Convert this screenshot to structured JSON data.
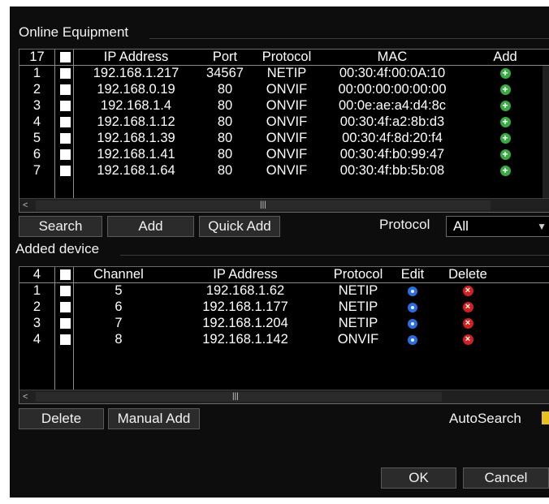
{
  "online": {
    "title": "Online Equipment",
    "count": "17",
    "headers": {
      "ip": "IP Address",
      "port": "Port",
      "protocol": "Protocol",
      "mac": "MAC",
      "add": "Add"
    },
    "rows": [
      {
        "no": "1",
        "ip": "192.168.1.217",
        "port": "34567",
        "protocol": "NETIP",
        "mac": "00:30:4f:00:0A:10"
      },
      {
        "no": "2",
        "ip": "192.168.0.19",
        "port": "80",
        "protocol": "ONVIF",
        "mac": "00:00:00:00:00:00"
      },
      {
        "no": "3",
        "ip": "192.168.1.4",
        "port": "80",
        "protocol": "ONVIF",
        "mac": "00:0e:ae:a4:d4:8c"
      },
      {
        "no": "4",
        "ip": "192.168.1.12",
        "port": "80",
        "protocol": "ONVIF",
        "mac": "00:30:4f:a2:8b:d3"
      },
      {
        "no": "5",
        "ip": "192.168.1.39",
        "port": "80",
        "protocol": "ONVIF",
        "mac": "00:30:4f:8d:20:f4"
      },
      {
        "no": "6",
        "ip": "192.168.1.41",
        "port": "80",
        "protocol": "ONVIF",
        "mac": "00:30:4f:b0:99:47"
      },
      {
        "no": "7",
        "ip": "192.168.1.64",
        "port": "80",
        "protocol": "ONVIF",
        "mac": "00:30:4f:bb:5b:08"
      }
    ]
  },
  "online_buttons": {
    "search": "Search",
    "add": "Add",
    "quick_add": "Quick Add"
  },
  "protocol_filter": {
    "label": "Protocol",
    "value": "All"
  },
  "added": {
    "title": "Added device",
    "count": "4",
    "headers": {
      "channel": "Channel",
      "ip": "IP Address",
      "protocol": "Protocol",
      "edit": "Edit",
      "delete": "Delete"
    },
    "rows": [
      {
        "no": "1",
        "channel": "5",
        "ip": "192.168.1.62",
        "protocol": "NETIP"
      },
      {
        "no": "2",
        "channel": "6",
        "ip": "192.168.1.177",
        "protocol": "NETIP"
      },
      {
        "no": "3",
        "channel": "7",
        "ip": "192.168.1.204",
        "protocol": "NETIP"
      },
      {
        "no": "4",
        "channel": "8",
        "ip": "192.168.1.142",
        "protocol": "ONVIF"
      }
    ]
  },
  "added_buttons": {
    "delete": "Delete",
    "manual_add": "Manual Add"
  },
  "autosearch": {
    "label": "AutoSearch",
    "checked": true
  },
  "footer": {
    "ok": "OK",
    "cancel": "Cancel"
  },
  "colors": {
    "background": "#0d0d0d",
    "add_icon": "#3aa845",
    "edit_icon": "#2c6ddc",
    "delete_icon": "#d02020",
    "checkbox_accent": "#e8c020"
  },
  "icons": {
    "add": "plus-circle-icon",
    "edit": "gear-icon",
    "delete": "x-circle-icon"
  }
}
